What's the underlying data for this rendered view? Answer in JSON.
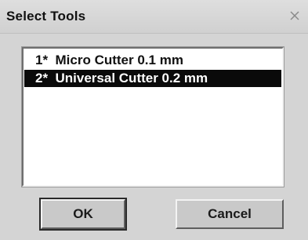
{
  "window": {
    "title": "Select Tools",
    "close_icon": "close-icon"
  },
  "tools_list": {
    "items": [
      {
        "label": "1*  Micro Cutter 0.1 mm",
        "selected": false
      },
      {
        "label": "2*  Universal Cutter 0.2 mm",
        "selected": true
      }
    ]
  },
  "buttons": {
    "ok_label": "OK",
    "cancel_label": "Cancel"
  },
  "colors": {
    "selection_background": "#0a0a0a",
    "selection_text": "#ffffff",
    "dialog_background": "#d4d4d4"
  }
}
